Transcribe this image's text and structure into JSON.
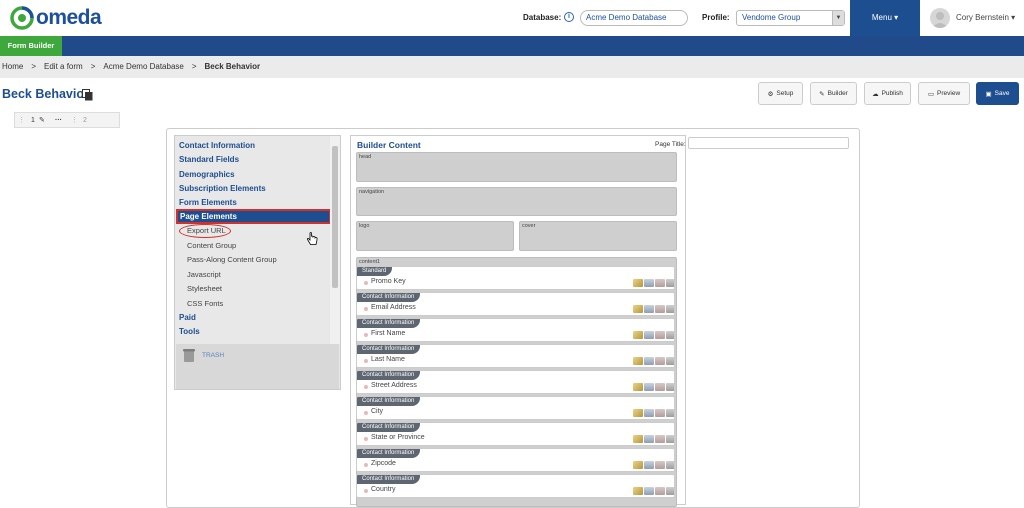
{
  "header": {
    "logo_text": "omeda",
    "database_label": "Database:",
    "database_value": "Acme Demo Database",
    "profile_label": "Profile:",
    "profile_value": "Vendome Group",
    "menu_label": "Menu ▾",
    "user_name": "Cory Bernstein ▾"
  },
  "nav": {
    "form_builder": "Form Builder"
  },
  "breadcrumb": {
    "items": [
      "Home",
      "Edit a form",
      "Acme Demo Database",
      "Beck Behavior"
    ],
    "sep": ">"
  },
  "page": {
    "title": "Beck Behavior"
  },
  "toolbar": {
    "setup": "Setup",
    "builder": "Builder",
    "publish": "Publish",
    "preview": "Preview",
    "save": "Save"
  },
  "pages_tabs": {
    "tab1": "1",
    "tab2": "2"
  },
  "left_panel": {
    "categories": [
      "Contact Information",
      "Standard Fields",
      "Demographics",
      "Subscription Elements",
      "Form Elements",
      "Page Elements"
    ],
    "page_elements": [
      "Export URL",
      "Content Group",
      "Pass-Along Content Group",
      "Javascript",
      "Stylesheet",
      "CSS Fonts"
    ],
    "after": [
      "Paid",
      "Tools"
    ],
    "trash_label": "TRASH"
  },
  "builder": {
    "title": "Builder Content",
    "page_title_label": "Page Title:",
    "zones": {
      "head": "head",
      "navigation": "navigation",
      "logo": "logo",
      "cover": "cover",
      "content1": "content1"
    },
    "fields": [
      {
        "tag": "Standard",
        "name": "Promo Key"
      },
      {
        "tag": "Contact Information",
        "name": "Email Address"
      },
      {
        "tag": "Contact Information",
        "name": "First Name"
      },
      {
        "tag": "Contact Information",
        "name": "Last Name"
      },
      {
        "tag": "Contact Information",
        "name": "Street Address"
      },
      {
        "tag": "Contact Information",
        "name": "City"
      },
      {
        "tag": "Contact Information",
        "name": "State or Province"
      },
      {
        "tag": "Contact Information",
        "name": "Zipcode"
      },
      {
        "tag": "Contact Information",
        "name": "Country"
      }
    ]
  },
  "colors": {
    "brand_blue": "#1d4e8f",
    "green": "#3ea83c",
    "highlight_red": "#d0312d"
  }
}
